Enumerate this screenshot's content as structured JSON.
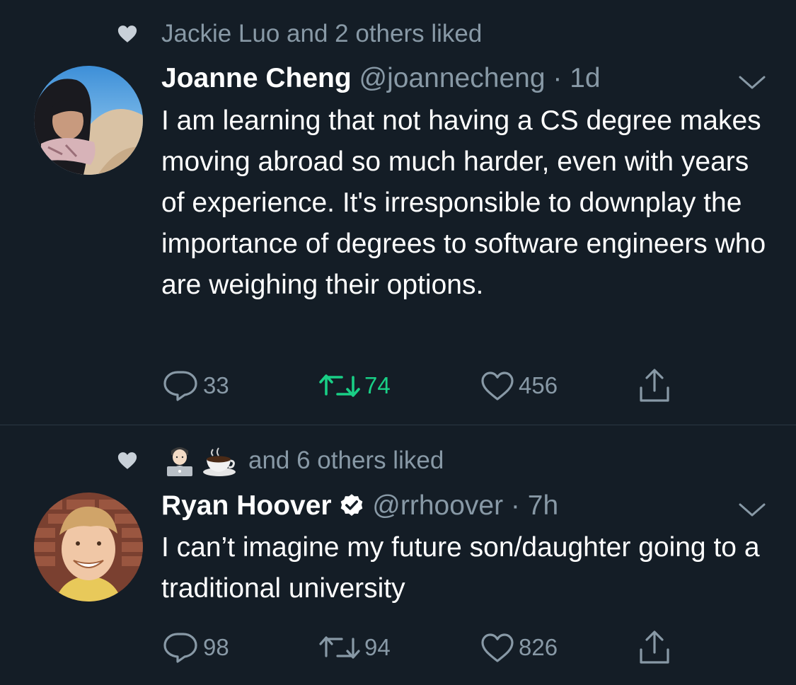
{
  "tweets": [
    {
      "social_context": "Jackie Luo and 2 others liked",
      "name": "Joanne Cheng",
      "handle": "@joannecheng",
      "separator": " · ",
      "time": "1d",
      "text": "I am learning that not having a CS degree makes moving abroad so much harder, even with years of experience. It's irresponsible to downplay the importance of degrees to software engineers who are weighing their options.",
      "reply_count": "33",
      "retweet_count": "74",
      "like_count": "456",
      "retweeted": true
    },
    {
      "social_context": "and 6 others liked",
      "context_emojis": [
        "technologist-emoji",
        "coffee-emoji"
      ],
      "name": "Ryan Hoover",
      "verified": true,
      "handle": "@rrhoover",
      "separator": " · ",
      "time": "7h",
      "text": "I can’t imagine my future son/daughter going to a traditional university",
      "reply_count": "98",
      "retweet_count": "94",
      "like_count": "826",
      "retweeted": false
    }
  ],
  "colors": {
    "background": "#141d26",
    "secondary_text": "#8899a6",
    "retweet_active": "#19cf86",
    "verified_badge": "#ffffff"
  }
}
